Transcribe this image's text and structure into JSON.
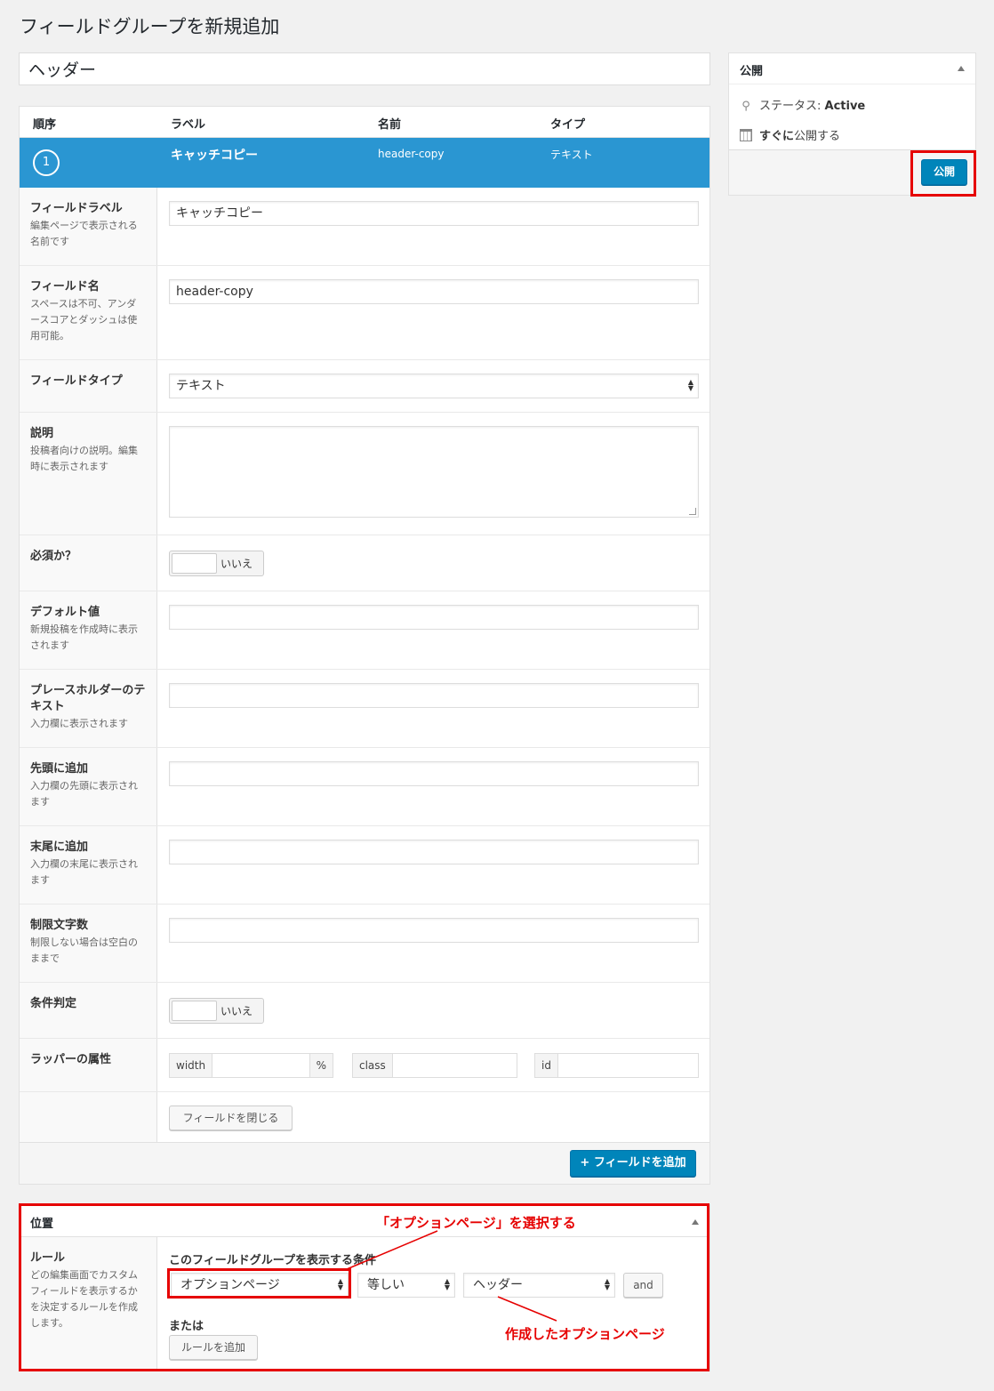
{
  "page": {
    "title": "フィールドグループを新規追加"
  },
  "group_title": {
    "value": "ヘッダー"
  },
  "fields_table": {
    "headers": [
      "順序",
      "ラベル",
      "名前",
      "タイプ"
    ],
    "row": {
      "order": "1",
      "label": "キャッチコピー",
      "name": "header-copy",
      "type": "テキスト"
    }
  },
  "settings": {
    "label": {
      "title": "フィールドラベル",
      "desc": "編集ページで表示される名前です",
      "value": "キャッチコピー"
    },
    "name": {
      "title": "フィールド名",
      "desc": "スペースは不可、アンダースコアとダッシュは使用可能。",
      "value": "header-copy"
    },
    "type": {
      "title": "フィールドタイプ",
      "value": "テキスト"
    },
    "instructions": {
      "title": "説明",
      "desc": "投稿者向けの説明。編集時に表示されます"
    },
    "required": {
      "title": "必須か？",
      "toggle": "いいえ"
    },
    "default": {
      "title": "デフォルト値",
      "desc": "新規投稿を作成時に表示されます"
    },
    "placeholder": {
      "title": "プレースホルダーのテキスト",
      "desc": "入力欄に表示されます"
    },
    "prepend": {
      "title": "先頭に追加",
      "desc": "入力欄の先頭に表示されます"
    },
    "append": {
      "title": "末尾に追加",
      "desc": "入力欄の末尾に表示されます"
    },
    "maxlength": {
      "title": "制限文字数",
      "desc": "制限しない場合は空白のままで"
    },
    "conditional": {
      "title": "条件判定",
      "toggle": "いいえ"
    },
    "wrapper": {
      "title": "ラッパーの属性",
      "width": "width",
      "width_unit": "%",
      "class": "class",
      "id": "id"
    },
    "close_button": "フィールドを閉じる"
  },
  "add_field_button": "+ フィールドを追加",
  "publish": {
    "title": "公開",
    "status_label": "ステータス: ",
    "status_value": "Active",
    "schedule_bold": "すぐに",
    "schedule_rest": "公開する",
    "button": "公開"
  },
  "location": {
    "title": "位置",
    "rules_title": "ルール",
    "rules_desc": "どの編集画面でカスタムフィールドを表示するかを決定するルールを作成します。",
    "condition_heading": "このフィールドグループを表示する条件",
    "param": "オプションページ",
    "operator": "等しい",
    "value": "ヘッダー",
    "and_button": "and",
    "or_label": "または",
    "add_rule_button": "ルールを追加"
  },
  "annotations": {
    "select_option": "「オプションページ」を選択する",
    "created_option": "作成したオプションページ"
  },
  "colors": {
    "accent": "#2a96d2",
    "primary_button": "#0085ba",
    "annotation": "#e60000"
  }
}
